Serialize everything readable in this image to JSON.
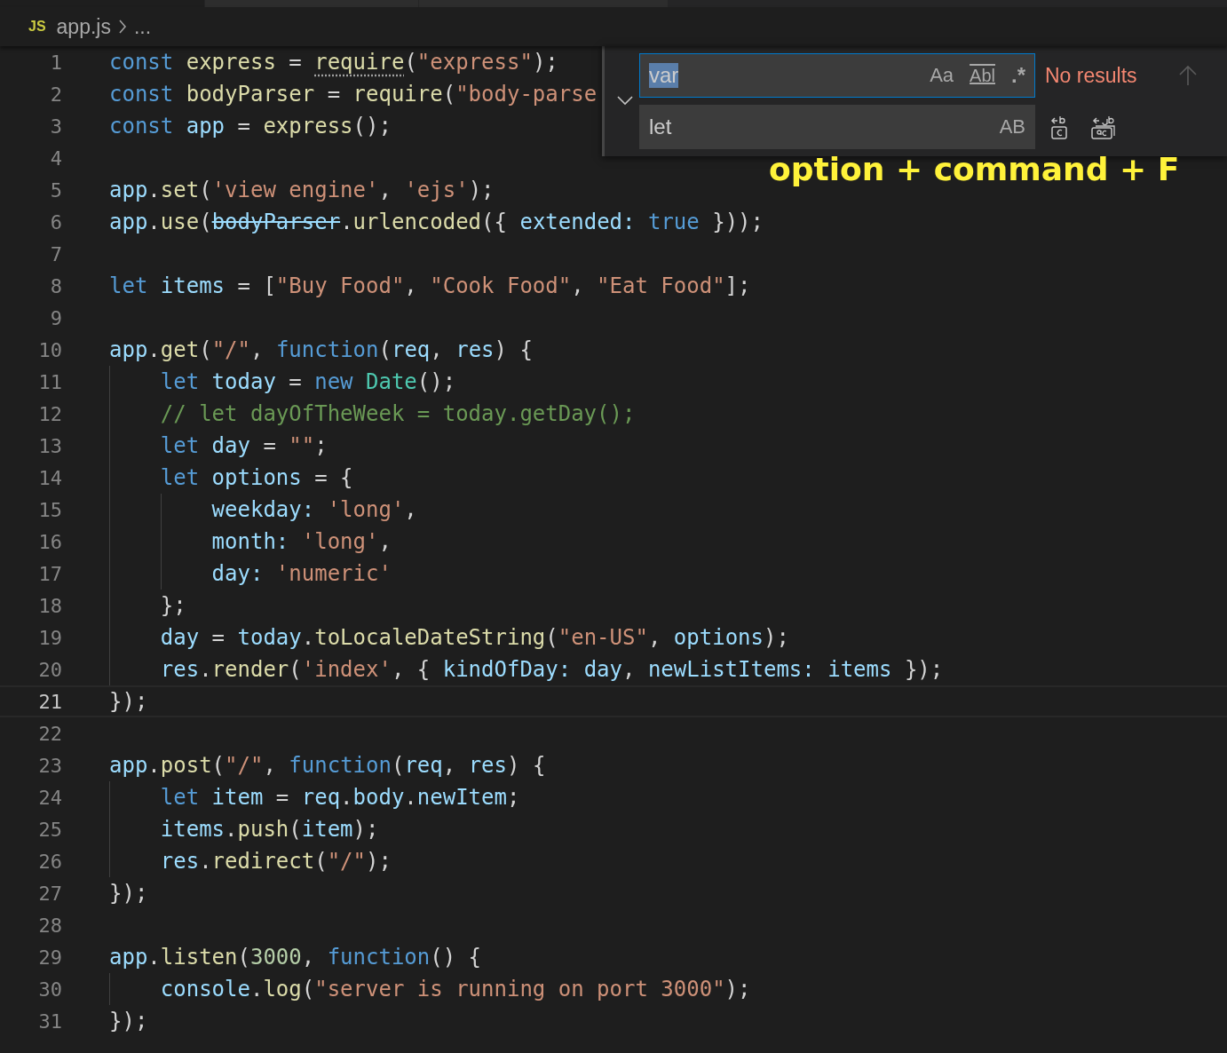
{
  "breadcrumb": {
    "file_badge": "JS",
    "file": "app.js",
    "more": "..."
  },
  "editor": {
    "lines": [
      {
        "number": "1",
        "current": false,
        "tokens": [
          {
            "kind": "keyword",
            "text": "const "
          },
          {
            "kind": "function",
            "text": "express"
          },
          {
            "kind": "plain",
            "text": " = "
          },
          {
            "kind": "hint",
            "text": "require"
          },
          {
            "kind": "plain",
            "text": "("
          },
          {
            "kind": "string",
            "text": "\"express\""
          },
          {
            "kind": "plain",
            "text": ");"
          }
        ]
      },
      {
        "number": "2",
        "current": false,
        "tokens": [
          {
            "kind": "keyword",
            "text": "const "
          },
          {
            "kind": "function",
            "text": "bodyParser"
          },
          {
            "kind": "plain",
            "text": " = "
          },
          {
            "kind": "function",
            "text": "require"
          },
          {
            "kind": "plain",
            "text": "("
          },
          {
            "kind": "string",
            "text": "\"body-parse"
          }
        ]
      },
      {
        "number": "3",
        "current": false,
        "tokens": [
          {
            "kind": "keyword",
            "text": "const "
          },
          {
            "kind": "variable",
            "text": "app"
          },
          {
            "kind": "plain",
            "text": " = "
          },
          {
            "kind": "function",
            "text": "express"
          },
          {
            "kind": "plain",
            "text": "();"
          }
        ]
      },
      {
        "number": "4",
        "current": false
      },
      {
        "number": "5",
        "current": false,
        "tokens": [
          {
            "kind": "variable",
            "text": "app"
          },
          {
            "kind": "plain",
            "text": "."
          },
          {
            "kind": "function",
            "text": "set"
          },
          {
            "kind": "plain",
            "text": "("
          },
          {
            "kind": "string",
            "text": "'view engine'"
          },
          {
            "kind": "plain",
            "text": ", "
          },
          {
            "kind": "string",
            "text": "'ejs'"
          },
          {
            "kind": "plain",
            "text": ");"
          }
        ]
      },
      {
        "number": "6",
        "current": false,
        "tokens": [
          {
            "kind": "variable",
            "text": "app"
          },
          {
            "kind": "plain",
            "text": "."
          },
          {
            "kind": "function",
            "text": "use"
          },
          {
            "kind": "plain",
            "text": "("
          },
          {
            "kind": "deprecated",
            "text": "bodyParser"
          },
          {
            "kind": "plain",
            "text": "."
          },
          {
            "kind": "function",
            "text": "urlencoded"
          },
          {
            "kind": "plain",
            "text": "({ "
          },
          {
            "kind": "variable",
            "text": "extended: "
          },
          {
            "kind": "keyword",
            "text": "true"
          },
          {
            "kind": "plain",
            "text": " }));"
          }
        ]
      },
      {
        "number": "7",
        "current": false
      },
      {
        "number": "8",
        "current": false,
        "tokens": [
          {
            "kind": "keyword",
            "text": "let "
          },
          {
            "kind": "variable",
            "text": "items"
          },
          {
            "kind": "plain",
            "text": " = ["
          },
          {
            "kind": "string",
            "text": "\"Buy Food\""
          },
          {
            "kind": "plain",
            "text": ", "
          },
          {
            "kind": "string",
            "text": "\"Cook Food\""
          },
          {
            "kind": "plain",
            "text": ", "
          },
          {
            "kind": "string",
            "text": "\"Eat Food\""
          },
          {
            "kind": "plain",
            "text": "];"
          }
        ]
      },
      {
        "number": "9",
        "current": false
      },
      {
        "number": "10",
        "current": false,
        "tokens": [
          {
            "kind": "variable",
            "text": "app"
          },
          {
            "kind": "plain",
            "text": "."
          },
          {
            "kind": "function",
            "text": "get"
          },
          {
            "kind": "plain",
            "text": "("
          },
          {
            "kind": "string",
            "text": "\"/\""
          },
          {
            "kind": "plain",
            "text": ", "
          },
          {
            "kind": "keyword",
            "text": "function"
          },
          {
            "kind": "plain",
            "text": "("
          },
          {
            "kind": "variable",
            "text": "req"
          },
          {
            "kind": "plain",
            "text": ", "
          },
          {
            "kind": "variable",
            "text": "res"
          },
          {
            "kind": "plain",
            "text": ") {"
          }
        ]
      },
      {
        "number": "11",
        "current": false,
        "tokens": [
          {
            "kind": "keyword",
            "text": "    let "
          },
          {
            "kind": "variable",
            "text": "today"
          },
          {
            "kind": "plain",
            "text": " = "
          },
          {
            "kind": "keyword",
            "text": "new "
          },
          {
            "kind": "class",
            "text": "Date"
          },
          {
            "kind": "plain",
            "text": "();"
          }
        ]
      },
      {
        "number": "12",
        "current": false,
        "tokens": [
          {
            "kind": "comment",
            "text": "    // let dayOfTheWeek = today.getDay();"
          }
        ]
      },
      {
        "number": "13",
        "current": false,
        "tokens": [
          {
            "kind": "keyword",
            "text": "    let "
          },
          {
            "kind": "variable",
            "text": "day"
          },
          {
            "kind": "plain",
            "text": " = "
          },
          {
            "kind": "string",
            "text": "\"\""
          },
          {
            "kind": "plain",
            "text": ";"
          }
        ]
      },
      {
        "number": "14",
        "current": false,
        "tokens": [
          {
            "kind": "keyword",
            "text": "    let "
          },
          {
            "kind": "variable",
            "text": "options"
          },
          {
            "kind": "plain",
            "text": " = {"
          }
        ]
      },
      {
        "number": "15",
        "current": false,
        "tokens": [
          {
            "kind": "variable",
            "text": "        weekday: "
          },
          {
            "kind": "string",
            "text": "'long'"
          },
          {
            "kind": "plain",
            "text": ","
          }
        ]
      },
      {
        "number": "16",
        "current": false,
        "tokens": [
          {
            "kind": "variable",
            "text": "        month: "
          },
          {
            "kind": "string",
            "text": "'long'"
          },
          {
            "kind": "plain",
            "text": ","
          }
        ]
      },
      {
        "number": "17",
        "current": false,
        "tokens": [
          {
            "kind": "variable",
            "text": "        day: "
          },
          {
            "kind": "string",
            "text": "'numeric'"
          }
        ]
      },
      {
        "number": "18",
        "current": false,
        "tokens": [
          {
            "kind": "plain",
            "text": "    };"
          }
        ]
      },
      {
        "number": "19",
        "current": false,
        "tokens": [
          {
            "kind": "variable",
            "text": "    day"
          },
          {
            "kind": "plain",
            "text": " = "
          },
          {
            "kind": "variable",
            "text": "today"
          },
          {
            "kind": "plain",
            "text": "."
          },
          {
            "kind": "function",
            "text": "toLocaleDateString"
          },
          {
            "kind": "plain",
            "text": "("
          },
          {
            "kind": "string",
            "text": "\"en-US\""
          },
          {
            "kind": "plain",
            "text": ", "
          },
          {
            "kind": "variable",
            "text": "options"
          },
          {
            "kind": "plain",
            "text": ");"
          }
        ]
      },
      {
        "number": "20",
        "current": false,
        "tokens": [
          {
            "kind": "variable",
            "text": "    res"
          },
          {
            "kind": "plain",
            "text": "."
          },
          {
            "kind": "function",
            "text": "render"
          },
          {
            "kind": "plain",
            "text": "("
          },
          {
            "kind": "string",
            "text": "'index'"
          },
          {
            "kind": "plain",
            "text": ", { "
          },
          {
            "kind": "variable",
            "text": "kindOfDay: day"
          },
          {
            "kind": "plain",
            "text": ", "
          },
          {
            "kind": "variable",
            "text": "newListItems: items"
          },
          {
            "kind": "plain",
            "text": " });"
          }
        ]
      },
      {
        "number": "21",
        "current": true,
        "tokens": [
          {
            "kind": "plain",
            "text": "});"
          }
        ]
      },
      {
        "number": "22",
        "current": false
      },
      {
        "number": "23",
        "current": false,
        "tokens": [
          {
            "kind": "variable",
            "text": "app"
          },
          {
            "kind": "plain",
            "text": "."
          },
          {
            "kind": "function",
            "text": "post"
          },
          {
            "kind": "plain",
            "text": "("
          },
          {
            "kind": "string",
            "text": "\"/\""
          },
          {
            "kind": "plain",
            "text": ", "
          },
          {
            "kind": "keyword",
            "text": "function"
          },
          {
            "kind": "plain",
            "text": "("
          },
          {
            "kind": "variable",
            "text": "req"
          },
          {
            "kind": "plain",
            "text": ", "
          },
          {
            "kind": "variable",
            "text": "res"
          },
          {
            "kind": "plain",
            "text": ") {"
          }
        ]
      },
      {
        "number": "24",
        "current": false,
        "tokens": [
          {
            "kind": "keyword",
            "text": "    let "
          },
          {
            "kind": "variable",
            "text": "item"
          },
          {
            "kind": "plain",
            "text": " = "
          },
          {
            "kind": "variable",
            "text": "req"
          },
          {
            "kind": "plain",
            "text": "."
          },
          {
            "kind": "variable",
            "text": "body"
          },
          {
            "kind": "plain",
            "text": "."
          },
          {
            "kind": "variable",
            "text": "newItem"
          },
          {
            "kind": "plain",
            "text": ";"
          }
        ]
      },
      {
        "number": "25",
        "current": false,
        "tokens": [
          {
            "kind": "variable",
            "text": "    items"
          },
          {
            "kind": "plain",
            "text": "."
          },
          {
            "kind": "function",
            "text": "push"
          },
          {
            "kind": "plain",
            "text": "("
          },
          {
            "kind": "variable",
            "text": "item"
          },
          {
            "kind": "plain",
            "text": ");"
          }
        ]
      },
      {
        "number": "26",
        "current": false,
        "tokens": [
          {
            "kind": "variable",
            "text": "    res"
          },
          {
            "kind": "plain",
            "text": "."
          },
          {
            "kind": "function",
            "text": "redirect"
          },
          {
            "kind": "plain",
            "text": "("
          },
          {
            "kind": "string",
            "text": "\"/\""
          },
          {
            "kind": "plain",
            "text": ");"
          }
        ]
      },
      {
        "number": "27",
        "current": false,
        "tokens": [
          {
            "kind": "plain",
            "text": "});"
          }
        ]
      },
      {
        "number": "28",
        "current": false
      },
      {
        "number": "29",
        "current": false,
        "tokens": [
          {
            "kind": "variable",
            "text": "app"
          },
          {
            "kind": "plain",
            "text": "."
          },
          {
            "kind": "function",
            "text": "listen"
          },
          {
            "kind": "plain",
            "text": "("
          },
          {
            "kind": "number",
            "text": "3000"
          },
          {
            "kind": "plain",
            "text": ", "
          },
          {
            "kind": "keyword",
            "text": "function"
          },
          {
            "kind": "plain",
            "text": "() {"
          }
        ]
      },
      {
        "number": "30",
        "current": false,
        "tokens": [
          {
            "kind": "variable",
            "text": "    console"
          },
          {
            "kind": "plain",
            "text": "."
          },
          {
            "kind": "function",
            "text": "log"
          },
          {
            "kind": "plain",
            "text": "("
          },
          {
            "kind": "string",
            "text": "\"server is running on port 3000\""
          },
          {
            "kind": "plain",
            "text": ");"
          }
        ]
      },
      {
        "number": "31",
        "current": false,
        "tokens": [
          {
            "kind": "plain",
            "text": "});"
          }
        ]
      }
    ]
  },
  "find_widget": {
    "expanded": true,
    "find": {
      "value": "var",
      "text_selected": true,
      "focused": true
    },
    "toggles": [
      {
        "kind": "case",
        "label": "Aa",
        "on": false
      },
      {
        "kind": "word",
        "label": "Abl",
        "on": false
      },
      {
        "kind": "regex",
        "label": ".*",
        "on": false
      }
    ],
    "status": "No results",
    "previous_disabled": true,
    "replace": {
      "value": "let",
      "focused": false
    },
    "preserve_case": {
      "label": "AB",
      "on": false
    }
  },
  "annotation": "option + command + F"
}
